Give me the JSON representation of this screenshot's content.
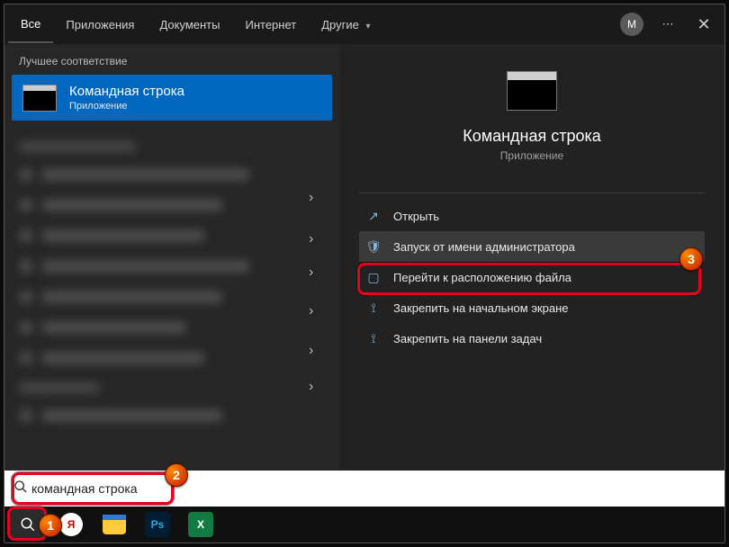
{
  "tabs": {
    "all": "Все",
    "apps": "Приложения",
    "docs": "Документы",
    "web": "Интернет",
    "more": "Другие"
  },
  "avatar_letter": "М",
  "left": {
    "section_label": "Лучшее соответствие",
    "best_match": {
      "title": "Командная строка",
      "subtitle": "Приложение"
    }
  },
  "preview": {
    "title": "Командная строка",
    "subtitle": "Приложение"
  },
  "actions": {
    "open": "Открыть",
    "run_admin": "Запуск от имени администратора",
    "open_location": "Перейти к расположению файла",
    "pin_start": "Закрепить на начальном экране",
    "pin_taskbar": "Закрепить на панели задач"
  },
  "search": {
    "value": "командная строка"
  },
  "badges": {
    "b1": "1",
    "b2": "2",
    "b3": "3"
  }
}
